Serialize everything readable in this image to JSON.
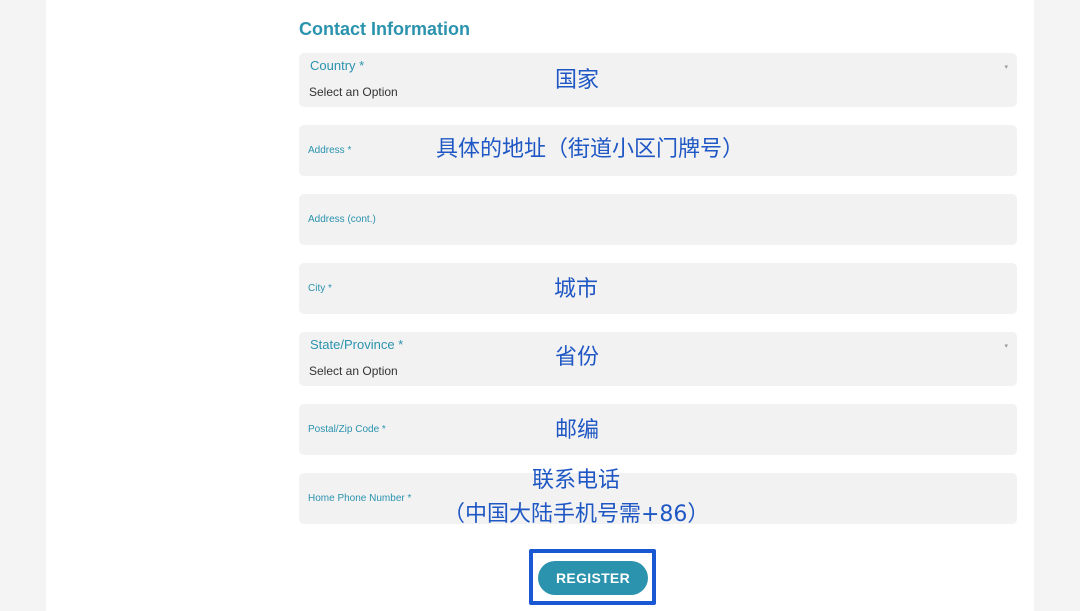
{
  "section": {
    "title": "Contact Information"
  },
  "fields": {
    "country": {
      "label": "Country *",
      "value": "Select an Option",
      "annotation": "国家"
    },
    "address": {
      "label": "Address *",
      "annotation": "具体的地址（街道小区门牌号）"
    },
    "address2": {
      "label": "Address (cont.)"
    },
    "city": {
      "label": "City *",
      "annotation": "城市"
    },
    "state": {
      "label": "State/Province *",
      "value": "Select an Option",
      "annotation": "省份"
    },
    "postal": {
      "label": "Postal/Zip Code *",
      "annotation": "邮编"
    },
    "phone": {
      "label": "Home Phone Number *",
      "annotation_line1": "联系电话",
      "annotation_line2": "（中国大陆手机号需+86）"
    }
  },
  "caret_glyph": "▾",
  "register": {
    "label": "REGISTER",
    "highlight_color": "#1a57d3"
  },
  "colors": {
    "accent": "#2b93ae",
    "annotation": "#1f57c4",
    "field_bg": "#f2f2f2"
  }
}
